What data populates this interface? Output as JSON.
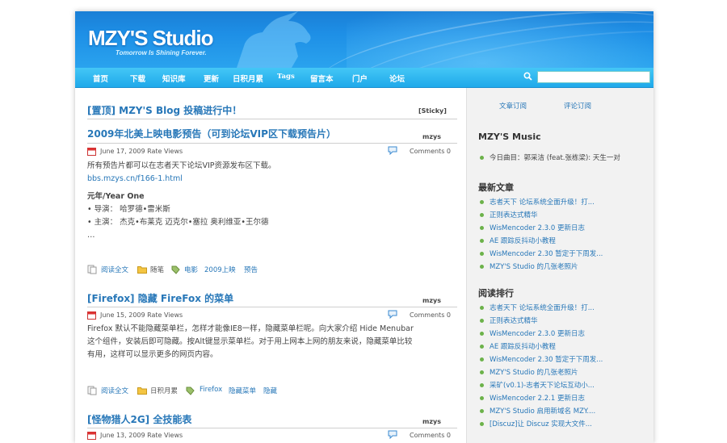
{
  "header": {
    "logo": "MZY'S Studio",
    "tagline": "Tomorrow Is Shining Forever."
  },
  "nav": {
    "items": [
      "首页",
      "下载",
      "知识库",
      "更新",
      "日积月累",
      "Tags",
      "留言本",
      "门户",
      "论坛"
    ],
    "search_value": ""
  },
  "posts": [
    {
      "title": "[置顶] MZY'S Blog 投稿进行中！",
      "badge": "[Sticky]"
    },
    {
      "title": "2009年北美上映电影预告（可到论坛VIP区下载预告片）",
      "author": "mzys",
      "date": "June 17, 2009 Rate  Views",
      "comments": "Comments 0",
      "body": [
        "所有预告片都可以在志者天下论坛VIP资源发布区下载。"
      ],
      "link": "bbs.mzys.cn/f166-1.html",
      "subheading": "元年/Year One",
      "bullets": [
        "• 导演： 哈罗德•雷米斯",
        "• 主演： 杰克•布莱克 迈克尔•塞拉 奥利维亚•王尔德"
      ],
      "ellipsis": "…",
      "read_more": "阅读全文",
      "category": "随笔",
      "tags": [
        "电影",
        "2009上映",
        "预告"
      ]
    },
    {
      "title": "[Firefox] 隐藏 FireFox 的菜单",
      "author": "mzys",
      "date": "June 15, 2009 Rate  Views",
      "comments": "Comments 0",
      "body": [
        "Firefox 默认不能隐藏菜单栏，怎样才能像IE8一样，隐藏菜单栏呢。向大家介绍 Hide Menubar",
        "这个组件，安装后即可隐藏。按Alt键显示菜单栏。对于用上网本上网的朋友来说，隐藏菜单比较",
        "有用，这样可以显示更多的网页内容。"
      ],
      "read_more": "阅读全文",
      "category": "日积月累",
      "tags": [
        "Firefox",
        "隐藏菜单",
        "隐藏"
      ]
    },
    {
      "title": "[怪物猎人2G] 全技能表",
      "author": "mzys",
      "date": "June 13, 2009 Rate  Views",
      "comments": "Comments 0"
    }
  ],
  "sidebar": {
    "tabs": [
      "文章订阅",
      "评论订阅"
    ],
    "music_title": "MZY'S Music",
    "music_item": "今日曲目：郭采洁 (feat.张栋梁): 天生一对",
    "latest_title": "最新文章",
    "latest": [
      "志者天下 论坛系统全面升级！打...",
      "正则表达式精华",
      "WisMencoder 2.3.0 更新日志",
      "AE 跟踪反抖动小教程",
      "WisMencoder 2.30 暂定于下周发...",
      "MZY'S Studio 的几张老照片"
    ],
    "popular_title": "阅读排行",
    "popular": [
      "志者天下 论坛系统全面升级！打...",
      "正则表达式精华",
      "WisMencoder 2.3.0 更新日志",
      "AE 跟踪反抖动小教程",
      "WisMencoder 2.30 暂定于下周发...",
      "MZY'S Studio 的几张老照片",
      "采矿(v0.1)-志者天下论坛互动小...",
      "WisMencoder 2.2.1 更新日志",
      "MZY'S Studio 启用新域名 MZY....",
      "[Discuz]让 Discuz 实现大文件..."
    ]
  },
  "colors": {
    "link": "#2777b8",
    "bullet": "#6cb24a",
    "header": "#1e8fe6"
  }
}
